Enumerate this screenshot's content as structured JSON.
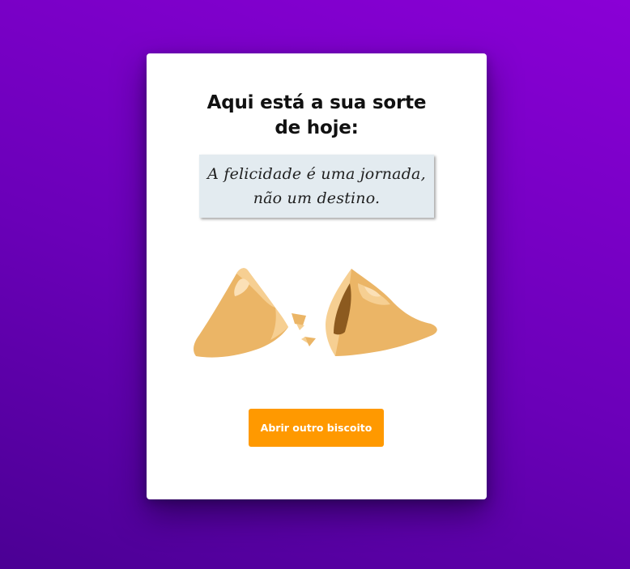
{
  "card": {
    "title_line1": "Aqui está a sua sorte",
    "title_line2": "de hoje:",
    "fortune_line1": "A felicidade é uma jornada,",
    "fortune_line2": "não um destino.",
    "cookie_image": "broken-fortune-cookie",
    "button_label": "Abrir outro biscoito"
  },
  "colors": {
    "background_start": "#4b0094",
    "background_end": "#8a00d6",
    "card": "#ffffff",
    "fortune_box": "#e3ebf0",
    "button": "#ff9900",
    "cookie": "#ebb566"
  }
}
